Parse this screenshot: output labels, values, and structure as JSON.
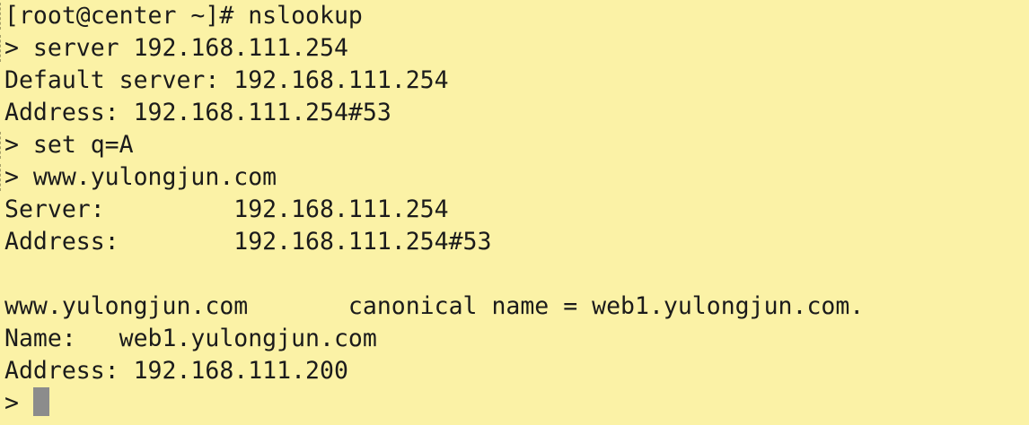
{
  "terminal": {
    "background": "#fbf2a6",
    "text_color": "#1b1b1b",
    "cursor_color": "#8c8c8c",
    "lines": [
      {
        "text": "[root@center ~]# nslookup",
        "marked": true
      },
      {
        "text": "> server 192.168.111.254",
        "marked": true
      },
      {
        "text": "Default server: 192.168.111.254",
        "marked": false
      },
      {
        "text": "Address: 192.168.111.254#53",
        "marked": false
      },
      {
        "text": "> set q=A",
        "marked": true
      },
      {
        "text": "> www.yulongjun.com",
        "marked": true
      },
      {
        "text": "Server:         192.168.111.254",
        "marked": false
      },
      {
        "text": "Address:        192.168.111.254#53",
        "marked": false
      },
      {
        "text": "",
        "marked": false
      },
      {
        "text": "www.yulongjun.com       canonical name = web1.yulongjun.com.",
        "marked": false
      },
      {
        "text": "Name:   web1.yulongjun.com",
        "marked": false
      },
      {
        "text": "Address: 192.168.111.200",
        "marked": false
      }
    ],
    "prompt": "> "
  }
}
